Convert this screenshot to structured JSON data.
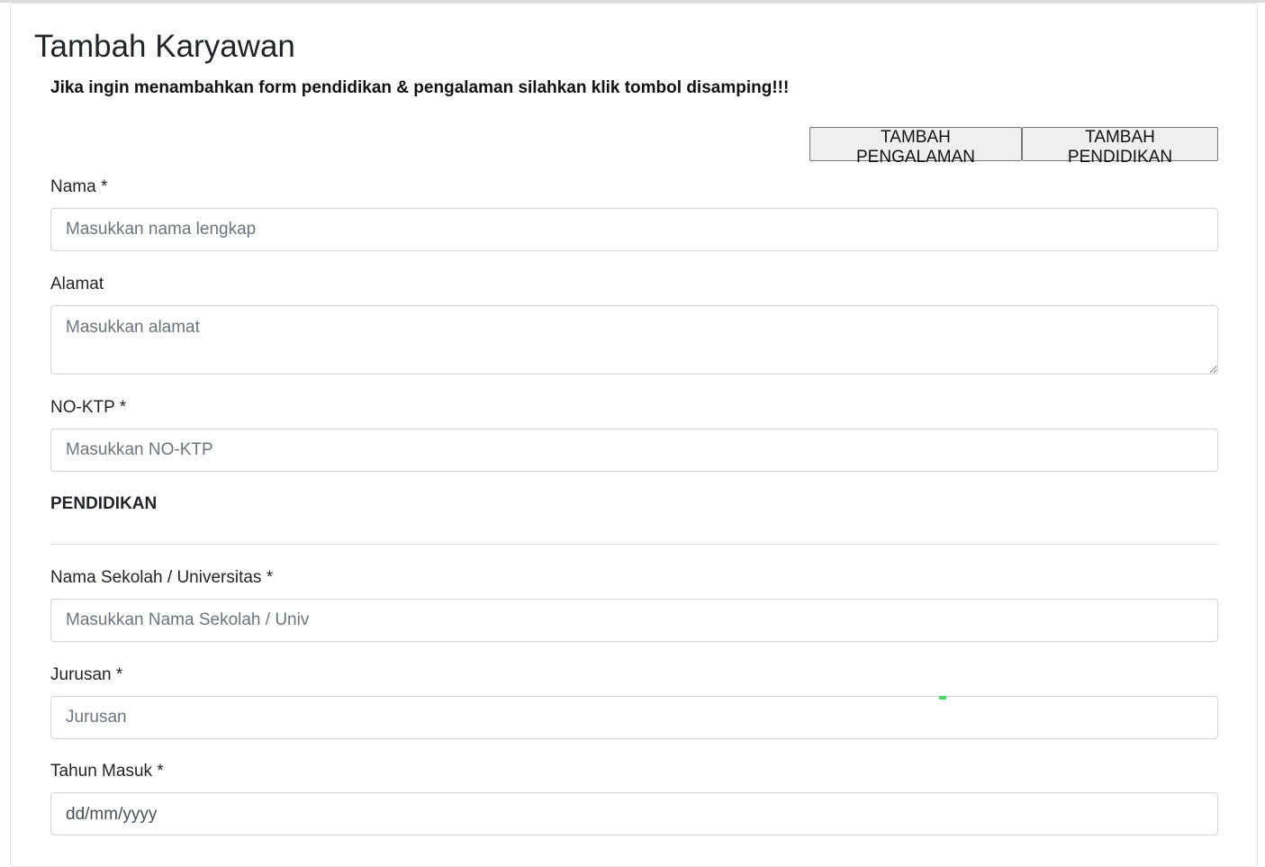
{
  "page": {
    "title": "Tambah Karyawan",
    "notice": "Jika ingin menambahkan form pendidikan & pengalaman silahkan klik tombol disamping!!!"
  },
  "buttons": {
    "add_experience": "TAMBAH PENGALAMAN",
    "add_education": "TAMBAH PENDIDIKAN"
  },
  "form": {
    "nama": {
      "label": "Nama *",
      "placeholder": "Masukkan nama lengkap",
      "value": ""
    },
    "alamat": {
      "label": "Alamat",
      "placeholder": "Masukkan alamat",
      "value": ""
    },
    "no_ktp": {
      "label": "NO-KTP *",
      "placeholder": "Masukkan NO-KTP",
      "value": ""
    }
  },
  "pendidikan": {
    "section_title": "PENDIDIKAN",
    "nama_sekolah": {
      "label": "Nama Sekolah / Universitas *",
      "placeholder": "Masukkan Nama Sekolah / Univ",
      "value": ""
    },
    "jurusan": {
      "label": "Jurusan *",
      "placeholder": "Jurusan",
      "value": ""
    },
    "tahun_masuk": {
      "label": "Tahun Masuk *",
      "display": "dd/mm/yyyy"
    }
  }
}
